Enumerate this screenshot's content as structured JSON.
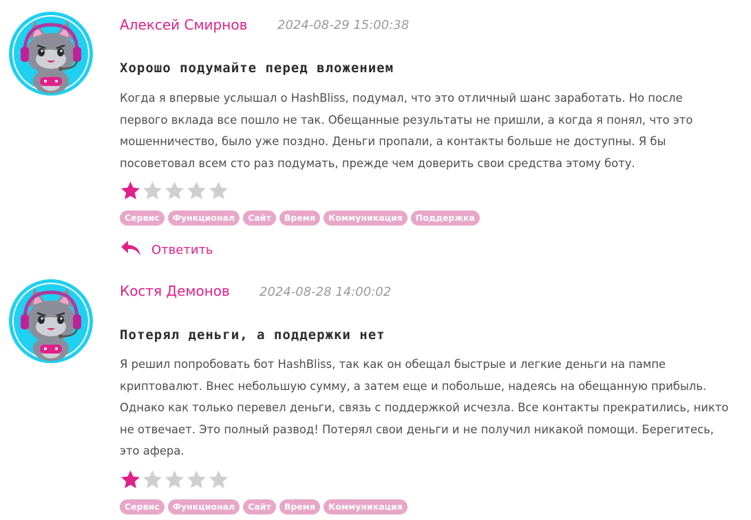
{
  "colors": {
    "accent": "#e0218a",
    "star_filled": "#e0218a",
    "star_empty": "#cfcfcf",
    "tag_bg": "#e8a6c8",
    "date": "#9a9a9a",
    "avatar_bg": "#1fd0f0"
  },
  "reviews": [
    {
      "author": "Алексей Смирнов",
      "date": "2024-08-29 15:00:38",
      "title": "Хорошо подумайте перед вложением",
      "body_lines": [
        "Когда я впервые услышал о HashBliss, подумал, что это отличный шанс заработать. Но после",
        "первого вклада все пошло не так. Обещанные результаты не пришли, а когда я понял, что это",
        "мошенничество, было уже поздно. Деньги пропали, а контакты больше не доступны. Я бы",
        "посоветовал всем сто раз подумать, прежде чем доверить свои средства этому боту."
      ],
      "rating": 1,
      "rating_max": 5,
      "tags": [
        "Сервис",
        "Функционал",
        "Сайт",
        "Время",
        "Коммуникация",
        "Поддержка"
      ],
      "reply_label": "Ответить",
      "avatar_icon": "cat-gamer-headset-avatar"
    },
    {
      "author": "Костя Демонов",
      "date": "2024-08-28 14:00:02",
      "title": "Потерял деньги, а поддержки нет",
      "body_lines": [
        "Я решил попробовать бот HashBliss, так как он обещал быстрые и легкие деньги на пампе",
        "криптовалют. Внес небольшую сумму, а затем еще и побольше, надеясь на обещанную прибыль.",
        "Однако как только перевел деньги, связь с поддержкой исчезла. Все контакты прекратились, никто",
        "не отвечает. Это полный развод! Потерял свои деньги и не получил никакой помощи. Берегитесь,",
        "это афера."
      ],
      "rating": 1,
      "rating_max": 5,
      "tags": [
        "Сервис",
        "Функционал",
        "Сайт",
        "Время",
        "Коммуникация"
      ],
      "avatar_icon": "cat-gamer-headset-avatar"
    }
  ]
}
